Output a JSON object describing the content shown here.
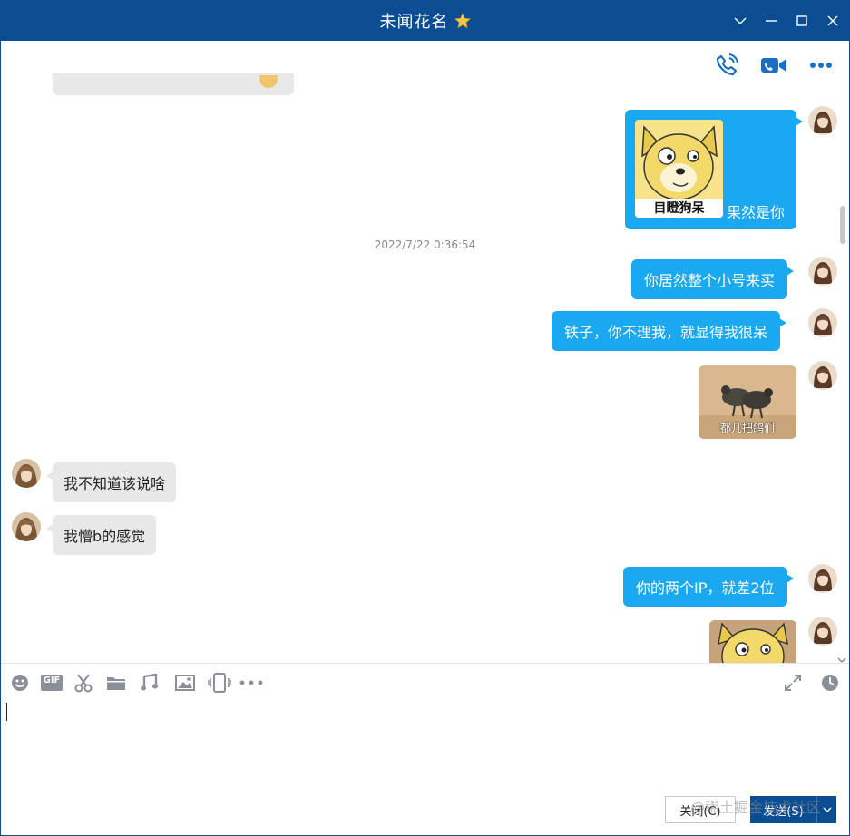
{
  "window": {
    "title": "未闻花名",
    "title_icon": "star-icon",
    "controls": [
      "chevron-down-icon",
      "minimize-icon",
      "maximize-icon",
      "close-icon"
    ]
  },
  "call_toolbar": {
    "icons": [
      "voice-call-icon",
      "video-call-icon",
      "more-icon"
    ]
  },
  "messages": [
    {
      "side": "in",
      "type": "text",
      "text": "",
      "note": "partially visible bubble at top"
    },
    {
      "side": "out",
      "type": "sticker-text",
      "sticker_caption": "目瞪狗呆",
      "text": "果然是你"
    },
    {
      "type": "timestamp",
      "text": "2022/7/22 0:36:54"
    },
    {
      "side": "out",
      "type": "text",
      "text": "你居然整个小号来买"
    },
    {
      "side": "out",
      "type": "text",
      "text": "铁子，你不理我，就显得我很呆"
    },
    {
      "side": "out",
      "type": "image",
      "caption": "都几把鸽们"
    },
    {
      "side": "in",
      "type": "text",
      "text": "我不知道该说啥"
    },
    {
      "side": "in",
      "type": "text",
      "text": "我懵b的感觉"
    },
    {
      "side": "out",
      "type": "text",
      "text": "你的两个IP，就差2位"
    },
    {
      "side": "out",
      "type": "image",
      "caption": ""
    }
  ],
  "input_toolbar": {
    "tools": [
      "emoji-icon",
      "gif-icon",
      "scissors-icon",
      "folder-icon",
      "music-icon",
      "image-icon",
      "shake-icon",
      "more-icon"
    ],
    "gif_label": "GIF",
    "right_tools": [
      "expand-icon",
      "history-icon"
    ]
  },
  "editor": {
    "value": ""
  },
  "buttons": {
    "close_label": "关闭(C)",
    "send_label": "发送(S)"
  },
  "watermark": "@稀土掘金技术社区",
  "colors": {
    "titlebar": "#0b4d92",
    "bubble_out": "#1aa8f0",
    "bubble_in": "#e8e8e8",
    "icon": "#1a6fc2"
  }
}
